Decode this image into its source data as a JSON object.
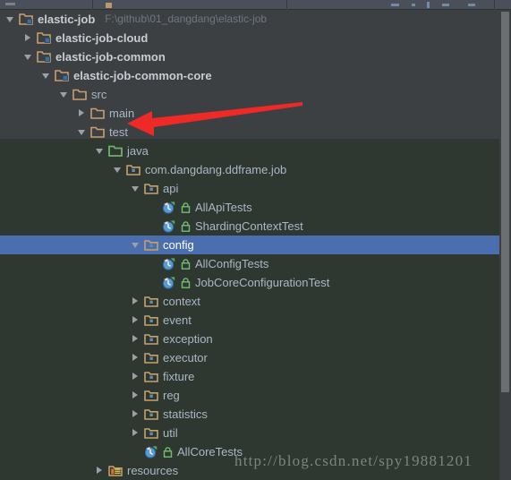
{
  "window": {
    "background_color": "#3c4043",
    "test_sources_tint_color": "#2f3830",
    "selection_color": "#4b6eaf",
    "accent_folder_color": "#c8a06a",
    "test_root_folder_color": "#6faf6f",
    "annotation_color": "#ed2a26"
  },
  "toolbar": {
    "description": "partially visible toolbar strip"
  },
  "project_root": {
    "label": "elastic-job",
    "path_hint": "F:\\github\\01_dangdang\\elastic-job"
  },
  "tree": {
    "rows": [
      {
        "label": "elastic-job",
        "path_hint": "F:\\github\\01_dangdang\\elastic-job",
        "icon": "module-icon",
        "toggle": "expanded",
        "depth": 0,
        "bold": true,
        "selected": false,
        "tinted": false
      },
      {
        "label": "elastic-job-cloud",
        "path_hint": "",
        "icon": "module-icon",
        "toggle": "collapsed",
        "depth": 1,
        "bold": true,
        "selected": false,
        "tinted": false
      },
      {
        "label": "elastic-job-common",
        "path_hint": "",
        "icon": "module-icon",
        "toggle": "expanded",
        "depth": 1,
        "bold": true,
        "selected": false,
        "tinted": false
      },
      {
        "label": "elastic-job-common-core",
        "path_hint": "",
        "icon": "module-icon",
        "toggle": "expanded",
        "depth": 2,
        "bold": true,
        "selected": false,
        "tinted": false
      },
      {
        "label": "src",
        "path_hint": "",
        "icon": "folder-icon",
        "toggle": "expanded",
        "depth": 3,
        "bold": false,
        "selected": false,
        "tinted": false
      },
      {
        "label": "main",
        "path_hint": "",
        "icon": "folder-icon",
        "toggle": "collapsed",
        "depth": 4,
        "bold": false,
        "selected": false,
        "tinted": false
      },
      {
        "label": "test",
        "path_hint": "",
        "icon": "folder-icon",
        "toggle": "expanded",
        "depth": 4,
        "bold": false,
        "selected": false,
        "tinted": false
      },
      {
        "label": "java",
        "path_hint": "",
        "icon": "test-source-folder-icon",
        "toggle": "expanded",
        "depth": 5,
        "bold": false,
        "selected": false,
        "tinted": true
      },
      {
        "label": "com.dangdang.ddframe.job",
        "path_hint": "",
        "icon": "package-icon",
        "toggle": "expanded",
        "depth": 6,
        "bold": false,
        "selected": false,
        "tinted": true
      },
      {
        "label": "api",
        "path_hint": "",
        "icon": "package-icon",
        "toggle": "expanded",
        "depth": 7,
        "bold": false,
        "selected": false,
        "tinted": true
      },
      {
        "label": "AllApiTests",
        "path_hint": "",
        "icon": "test-class-icon",
        "toggle": "none",
        "depth": 8,
        "bold": false,
        "selected": false,
        "tinted": true
      },
      {
        "label": "ShardingContextTest",
        "path_hint": "",
        "icon": "test-class-icon",
        "toggle": "none",
        "depth": 8,
        "bold": false,
        "selected": false,
        "tinted": true
      },
      {
        "label": "config",
        "path_hint": "",
        "icon": "package-icon",
        "toggle": "expanded",
        "depth": 7,
        "bold": false,
        "selected": true,
        "tinted": true
      },
      {
        "label": "AllConfigTests",
        "path_hint": "",
        "icon": "test-class-icon",
        "toggle": "none",
        "depth": 8,
        "bold": false,
        "selected": false,
        "tinted": true
      },
      {
        "label": "JobCoreConfigurationTest",
        "path_hint": "",
        "icon": "test-class-icon",
        "toggle": "none",
        "depth": 8,
        "bold": false,
        "selected": false,
        "tinted": true
      },
      {
        "label": "context",
        "path_hint": "",
        "icon": "package-icon",
        "toggle": "collapsed",
        "depth": 7,
        "bold": false,
        "selected": false,
        "tinted": true
      },
      {
        "label": "event",
        "path_hint": "",
        "icon": "package-icon",
        "toggle": "collapsed",
        "depth": 7,
        "bold": false,
        "selected": false,
        "tinted": true
      },
      {
        "label": "exception",
        "path_hint": "",
        "icon": "package-icon",
        "toggle": "collapsed",
        "depth": 7,
        "bold": false,
        "selected": false,
        "tinted": true
      },
      {
        "label": "executor",
        "path_hint": "",
        "icon": "package-icon",
        "toggle": "collapsed",
        "depth": 7,
        "bold": false,
        "selected": false,
        "tinted": true
      },
      {
        "label": "fixture",
        "path_hint": "",
        "icon": "package-icon",
        "toggle": "collapsed",
        "depth": 7,
        "bold": false,
        "selected": false,
        "tinted": true
      },
      {
        "label": "reg",
        "path_hint": "",
        "icon": "package-icon",
        "toggle": "collapsed",
        "depth": 7,
        "bold": false,
        "selected": false,
        "tinted": true
      },
      {
        "label": "statistics",
        "path_hint": "",
        "icon": "package-icon",
        "toggle": "collapsed",
        "depth": 7,
        "bold": false,
        "selected": false,
        "tinted": true
      },
      {
        "label": "util",
        "path_hint": "",
        "icon": "package-icon",
        "toggle": "collapsed",
        "depth": 7,
        "bold": false,
        "selected": false,
        "tinted": true
      },
      {
        "label": "AllCoreTests",
        "path_hint": "",
        "icon": "test-class-icon",
        "toggle": "none",
        "depth": 7,
        "bold": false,
        "selected": false,
        "tinted": true
      },
      {
        "label": "resources",
        "path_hint": "",
        "icon": "resources-folder-icon",
        "toggle": "collapsed",
        "depth": 5,
        "bold": false,
        "selected": false,
        "tinted": true
      }
    ]
  },
  "annotation": {
    "type": "arrow",
    "points_to": "test",
    "color": "#ed2a26"
  },
  "watermark": {
    "text": "http://blog.csdn.net/spy19881201"
  },
  "scrollbar": {
    "orientation": "vertical"
  }
}
